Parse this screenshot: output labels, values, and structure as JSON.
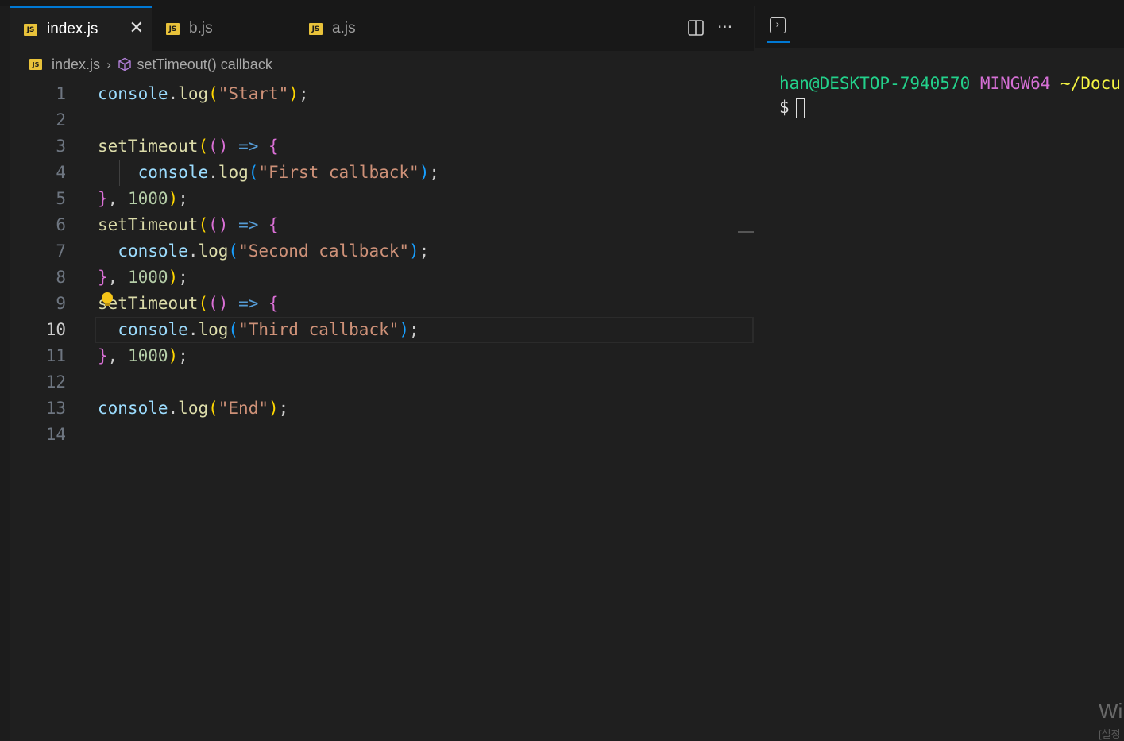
{
  "tabs": [
    {
      "label": "index.js",
      "active": true,
      "badge": "JS"
    },
    {
      "label": "b.js",
      "active": false,
      "badge": "JS"
    },
    {
      "label": "a.js",
      "active": false,
      "badge": "JS"
    }
  ],
  "tab_close": "✕",
  "toolbar": {
    "split_icon": "split-editor-icon",
    "more_icon": "more-actions-icon",
    "more_glyph": "···"
  },
  "breadcrumb": {
    "file": "index.js",
    "symbol": "setTimeout() callback"
  },
  "colors": {
    "plain": "#9cdcfe",
    "fn": "#dcdcaa",
    "string": "#ce9178",
    "number": "#b5cea8",
    "bracket1": "#ffd700",
    "bracket2": "#da70d6",
    "bracket3": "#179fff",
    "arrow": "#569cd6",
    "punct": "#cccccc",
    "accent": "#0078d4",
    "term_user": "#23d18b",
    "term_mingw": "#d670d6",
    "term_path": "#f5f543"
  },
  "code_lines": [
    {
      "n": "1",
      "text": "console.log(\"Start\");"
    },
    {
      "n": "2",
      "text": ""
    },
    {
      "n": "3",
      "text": "setTimeout(() => {"
    },
    {
      "n": "4",
      "text": "    console.log(\"First callback\");"
    },
    {
      "n": "5",
      "text": "}, 1000);"
    },
    {
      "n": "6",
      "text": "setTimeout(() => {"
    },
    {
      "n": "7",
      "text": "  console.log(\"Second callback\");"
    },
    {
      "n": "8",
      "text": "}, 1000);"
    },
    {
      "n": "9",
      "text": "setTimeout(() => {"
    },
    {
      "n": "10",
      "text": "  console.log(\"Third callback\");",
      "current": true
    },
    {
      "n": "11",
      "text": "}, 1000);"
    },
    {
      "n": "12",
      "text": ""
    },
    {
      "n": "13",
      "text": "console.log(\"End\");"
    },
    {
      "n": "14",
      "text": ""
    }
  ],
  "terminal": {
    "user": "han@DESKTOP-7940570",
    "shell": "MINGW64",
    "path": "~/Docu",
    "prompt": "$"
  },
  "watermark": {
    "line1": "Wi",
    "line2": "[설정"
  }
}
